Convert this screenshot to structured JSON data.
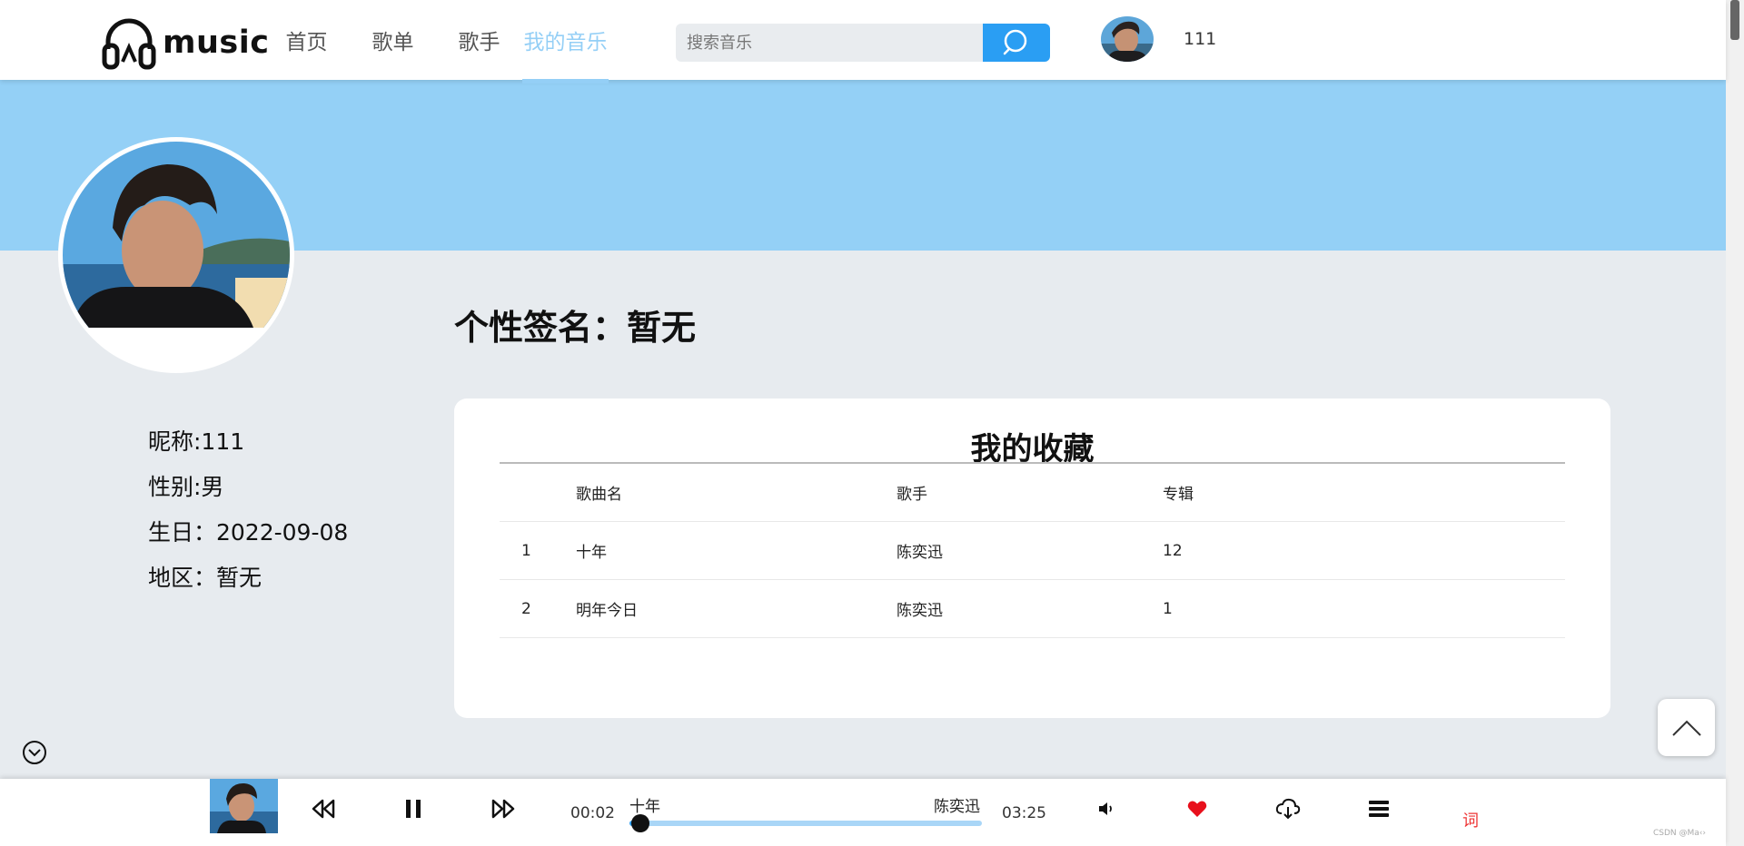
{
  "header": {
    "logo_text": "music",
    "nav": [
      {
        "label": "首页",
        "active": false
      },
      {
        "label": "歌单",
        "active": false
      },
      {
        "label": "歌手",
        "active": false
      },
      {
        "label": "我的音乐",
        "active": true
      }
    ],
    "search_placeholder": "搜索音乐",
    "username": "111"
  },
  "profile": {
    "nickname": "昵称:111",
    "gender": "性别:男",
    "birthday": "生日：2022-09-08",
    "region": "地区：暂无",
    "signature": "个性签名：暂无"
  },
  "favorites": {
    "title": "我的收藏",
    "columns": [
      "",
      "歌曲名",
      "歌手",
      "专辑"
    ],
    "rows": [
      {
        "index": "1",
        "name": "十年",
        "singer": "陈奕迅",
        "album": "12"
      },
      {
        "index": "2",
        "name": "明年今日",
        "singer": "陈奕迅",
        "album": "1"
      }
    ]
  },
  "player": {
    "current_time": "00:02",
    "total_time": "03:25",
    "song_title": "十年",
    "song_artist": "陈奕迅",
    "progress_fraction": 0.03,
    "lyric_label": "词",
    "favorite_color": "#e8101c"
  },
  "watermark": "CSDN @Ma‹›",
  "colors": {
    "accent": "#94cff6",
    "search_button": "#2a9ef3",
    "banner": "#94d0f6"
  }
}
